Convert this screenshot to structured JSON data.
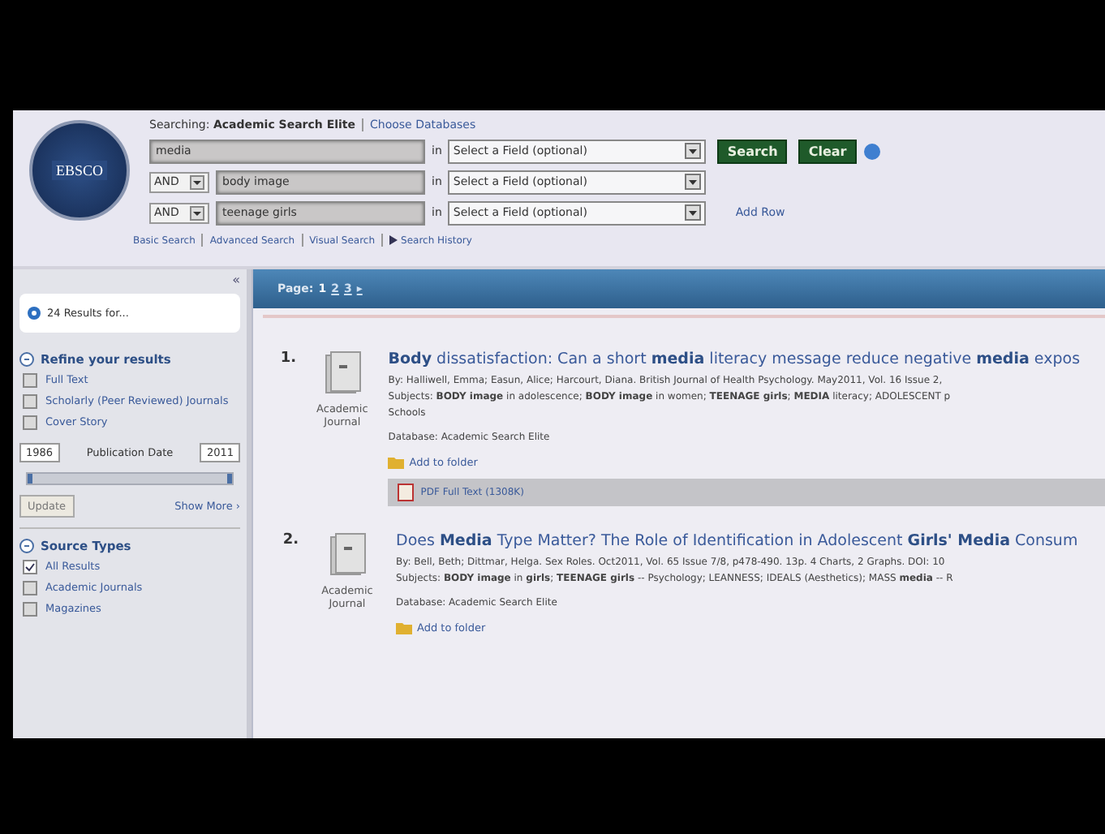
{
  "header": {
    "logo": "EBSCO",
    "searching_label": "Searching:",
    "database": "Academic Search Elite",
    "choose_databases": "Choose Databases",
    "rows": [
      {
        "operator": null,
        "term": "media",
        "in_label": "in",
        "field": "Select a Field (optional)"
      },
      {
        "operator": "AND",
        "term": "body image",
        "in_label": "in",
        "field": "Select a Field (optional)"
      },
      {
        "operator": "AND",
        "term": "teenage girls",
        "in_label": "in",
        "field": "Select a Field (optional)"
      }
    ],
    "buttons": [
      "Search",
      "Clear"
    ],
    "add_row": "Add Row",
    "links": [
      "Basic Search",
      "Advanced Search",
      "Visual Search",
      "Search History"
    ]
  },
  "sidebar": {
    "collapse": "«",
    "results_for": "24 Results for...",
    "refine_title": "Refine your results",
    "refine_options": [
      {
        "label": "Full Text",
        "checked": false
      },
      {
        "label": "Scholarly (Peer Reviewed) Journals",
        "checked": false
      },
      {
        "label": "Cover Story",
        "checked": false
      }
    ],
    "date_from": "1986",
    "date_label": "Publication Date",
    "date_to": "2011",
    "date_slider": {
      "level": 1
    },
    "update": "Update",
    "show_more": "Show More ›",
    "source_title": "Source Types",
    "source_options": [
      {
        "label": "All Results",
        "checked": true
      },
      {
        "label": "Academic Journals",
        "checked": false
      },
      {
        "label": "Magazines",
        "checked": false
      }
    ]
  },
  "results": {
    "page_label": "Page:",
    "pages": [
      {
        "label": "1",
        "selected": true
      },
      {
        "label": "2",
        "selected": false
      },
      {
        "label": "3",
        "selected": false
      }
    ],
    "next": "▸",
    "items": [
      {
        "number": "1.",
        "type": "Academic Journal",
        "title": "**Body** dissatisfaction: Can a short **media** literacy message reduce negative **media** expos",
        "byline": "By: Halliwell, Emma; Easun, Alice; Harcourt, Diana. British Journal of Health Psychology. May2011, Vol. 16 Issue 2,",
        "subjects": "Subjects: **BODY image** in adolescence; **BODY image** in women; **TEENAGE girls**; **MEDIA** literacy; ADOLESCENT p",
        "subjects_more": "Schools",
        "database": "Database: Academic Search Elite",
        "folder": "Add to folder",
        "pdf": "PDF Full Text (1308K)"
      },
      {
        "number": "2.",
        "type": "Academic Journal",
        "title": "Does **Media** Type Matter? The Role of Identification in Adolescent **Girls' Media** Consum",
        "byline": "By: Bell, Beth; Dittmar, Helga. Sex Roles. Oct2011, Vol. 65 Issue 7/8, p478-490. 13p. 4 Charts, 2 Graphs. DOI: 10",
        "subjects": "Subjects: **BODY image** in **girls**; **TEENAGE girls** -- Psychology; LEANNESS; IDEALS (Aesthetics); MASS **media** -- R",
        "database": "Database: Academic Search Elite",
        "folder": "Add to folder"
      }
    ]
  }
}
